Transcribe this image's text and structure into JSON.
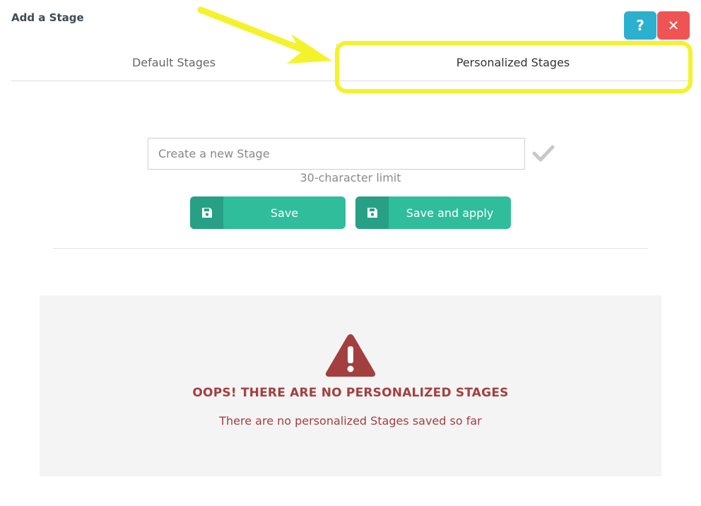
{
  "dialog": {
    "title": "Add a Stage",
    "help_label": "?",
    "close_label": "✕"
  },
  "tabs": [
    {
      "label": "Default Stages",
      "active": false
    },
    {
      "label": "Personalized Stages",
      "active": true
    }
  ],
  "form": {
    "input_placeholder": "Create a new Stage",
    "input_value": "",
    "limit_text": "30-character limit",
    "save_label": "Save",
    "save_apply_label": "Save and apply"
  },
  "empty_state": {
    "title": "OOPS! THERE ARE NO PERSONALIZED STAGES",
    "description": "There are no personalized Stages saved so far"
  },
  "icons": {
    "help": "question-mark-icon",
    "close": "close-icon",
    "confirm": "checkmark-icon",
    "save": "floppy-disk-icon",
    "warning": "warning-triangle-icon",
    "annotation": "arrow-icon"
  },
  "colors": {
    "accent_green": "#2fbd9c",
    "accent_green_dark": "#27a085",
    "help_blue": "#2bb0cf",
    "close_red": "#ef5455",
    "error_red": "#a33f3f",
    "highlight_yellow": "#f4f22b"
  }
}
